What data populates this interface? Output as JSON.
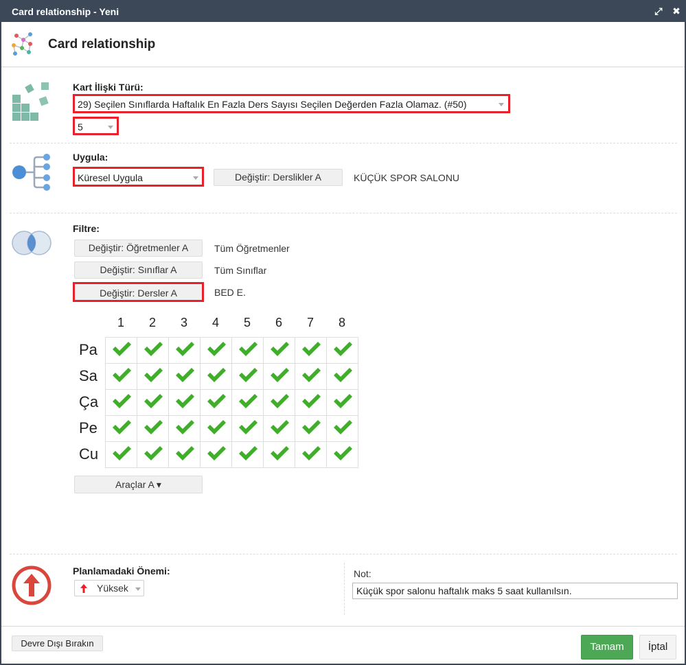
{
  "window": {
    "title": "Card relationship - Yeni",
    "icons": [
      "expand-icon",
      "close-icon"
    ],
    "expand_glyph": "⤢",
    "close_glyph": "✖"
  },
  "header": {
    "title": "Card relationship"
  },
  "relation_type": {
    "label": "Kart İlişki Türü:",
    "selected": "29) Seçilen Sınıflarda Haftalık En Fazla Ders Sayısı Seçilen Değerden Fazla Olamaz. (#50)",
    "value": "5"
  },
  "apply": {
    "label": "Uygula:",
    "selected": "Küresel Uygula",
    "change_button": "Değiştir: Derslikler A",
    "target": "KÜÇÜK SPOR SALONU"
  },
  "filter": {
    "label": "Filtre:",
    "rows": [
      {
        "button": "Değiştir: Öğretmenler A",
        "value": "Tüm Öğretmenler"
      },
      {
        "button": "Değiştir: Sınıflar A",
        "value": "Tüm Sınıflar"
      },
      {
        "button": "Değiştir: Dersler A",
        "value": "BED E."
      }
    ]
  },
  "grid": {
    "columns": [
      "1",
      "2",
      "3",
      "4",
      "5",
      "6",
      "7",
      "8"
    ],
    "rows": [
      "Pa",
      "Sa",
      "Ça",
      "Pe",
      "Cu"
    ],
    "all_checked": true
  },
  "tools_button": "Araçlar A ▾",
  "importance": {
    "label": "Planlamadaki Önemi:",
    "selected": "Yüksek"
  },
  "note": {
    "label": "Not:",
    "value": "Küçük spor salonu haftalık maks 5 saat kullanılsın."
  },
  "footer": {
    "disable_button": "Devre Dışı Bırakın",
    "ok_button": "Tamam",
    "cancel_button": "İptal"
  },
  "colors": {
    "titlebar": "#3c4858",
    "highlight": "#e8202a",
    "check": "#3fae29",
    "ok": "#4ca855"
  }
}
